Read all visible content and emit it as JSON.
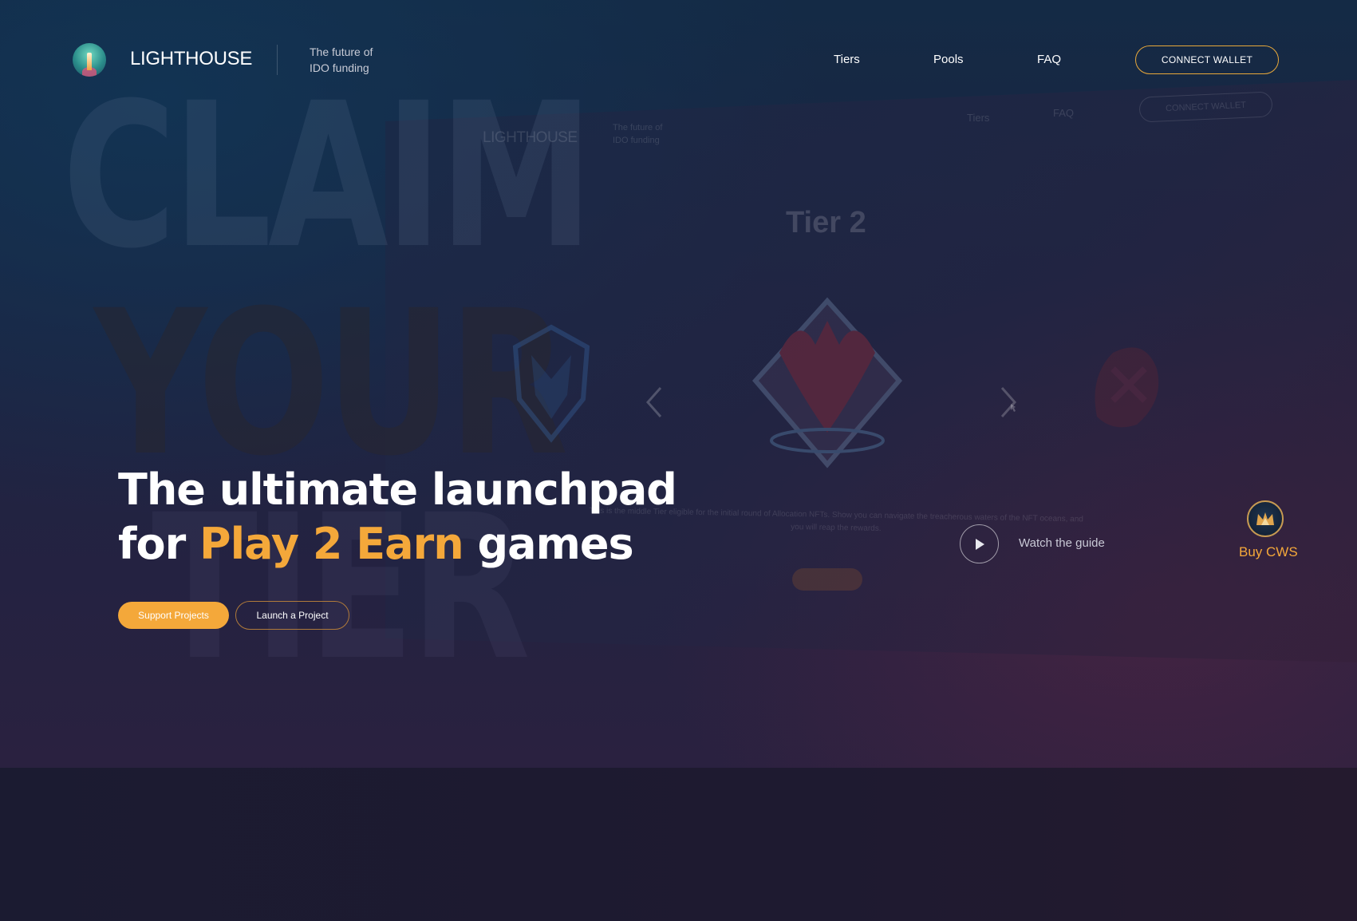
{
  "header": {
    "logo_text": "LIGHTHOUSE",
    "tagline_line1": "The future of",
    "tagline_line2": "IDO funding",
    "nav": {
      "tiers": "Tiers",
      "pools": "Pools",
      "faq": "FAQ"
    },
    "connect_wallet": "CONNECT WALLET"
  },
  "background": {
    "big_words": [
      "CLAIM",
      "YOUR",
      "TIER"
    ],
    "preview": {
      "logo_text": "LIGHTHOUSE",
      "tagline_line1": "The future of",
      "tagline_line2": "IDO funding",
      "nav_tiers": "Tiers",
      "nav_faq": "FAQ",
      "connect_wallet": "CONNECT WALLET",
      "tier_title": "Tier 2",
      "tier_description": "This is the middle Tier eligible for the initial round of Allocation NFTs. Show you can navigate the treacherous waters of the NFT oceans, and you will reap the rewards."
    }
  },
  "hero": {
    "headline_line1": "The ultimate launchpad",
    "headline_for": "for ",
    "headline_accent": "Play 2 Earn",
    "headline_end": " games",
    "support_button": "Support Projects",
    "launch_button": "Launch a Project",
    "watch_guide": "Watch the guide",
    "buy_cws": "Buy CWS"
  },
  "colors": {
    "accent": "#f4a83a",
    "background": "#1c1b2f"
  },
  "icons": {
    "logo": "lighthouse-icon",
    "play": "play-icon",
    "coin": "crown-icon",
    "carousel_prev": "chevron-left-icon",
    "carousel_next": "chevron-right-icon"
  }
}
